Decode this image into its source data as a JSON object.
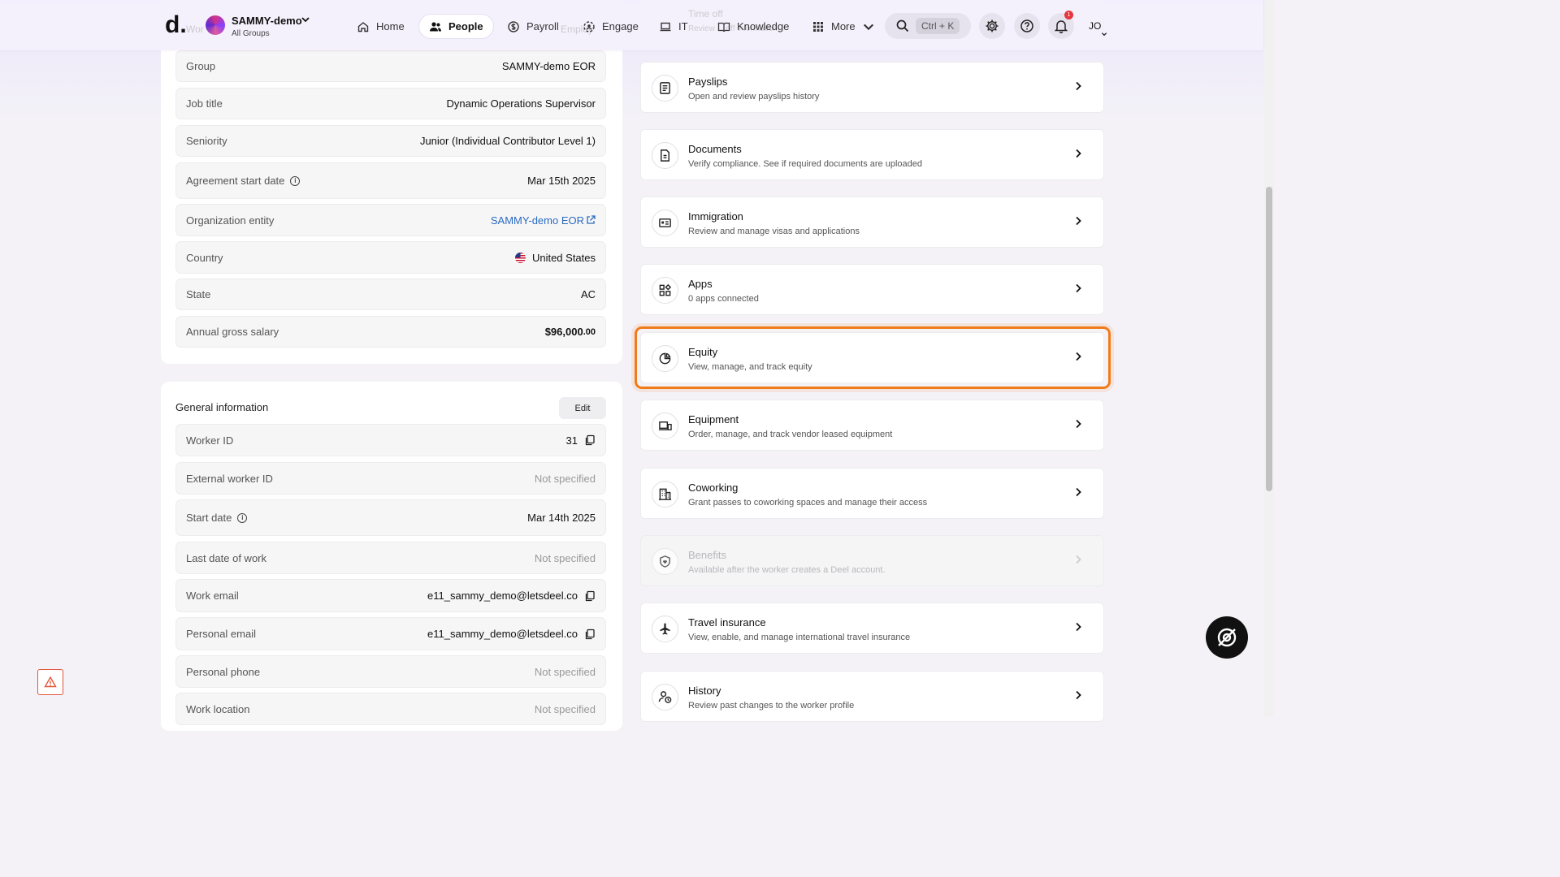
{
  "nav": {
    "org_name": "SAMMY-demo",
    "org_sub": "All Groups",
    "items": [
      {
        "label": "Home",
        "icon": "home-icon"
      },
      {
        "label": "People",
        "icon": "people-icon",
        "active": true
      },
      {
        "label": "Payroll",
        "icon": "dollar-icon"
      },
      {
        "label": "Engage",
        "icon": "engage-icon"
      },
      {
        "label": "IT",
        "icon": "laptop-icon"
      },
      {
        "label": "Knowledge",
        "icon": "book-icon"
      },
      {
        "label": "More",
        "icon": "grid-icon"
      }
    ],
    "search_shortcut": "Ctrl + K",
    "notification_count": "1",
    "user_initials": "JO",
    "ghost_left": "Wor",
    "ghost_mid": "Employ",
    "ghost_right": "Time off",
    "ghost_right_desc": "Review ... off information"
  },
  "employment": {
    "rows": [
      {
        "label": "Group",
        "value": "SAMMY-demo EOR"
      },
      {
        "label": "Job title",
        "value": "Dynamic Operations Supervisor"
      },
      {
        "label": "Seniority",
        "value": "Junior (Individual Contributor Level 1)"
      },
      {
        "label": "Agreement start date",
        "value": "Mar 15th 2025",
        "info": true
      },
      {
        "label": "Organization entity",
        "value": "SAMMY-demo EOR",
        "link": true
      },
      {
        "label": "Country",
        "value": "United States",
        "flag": true
      },
      {
        "label": "State",
        "value": "AC"
      },
      {
        "label": "Annual gross salary",
        "value": "$96,000",
        "cents": ".00"
      }
    ]
  },
  "general": {
    "title": "General information",
    "edit_label": "Edit",
    "rows": [
      {
        "label": "Worker ID",
        "value": "31",
        "copy": true
      },
      {
        "label": "External worker ID",
        "value": "Not specified",
        "muted": true
      },
      {
        "label": "Start date",
        "value": "Mar 14th 2025",
        "info": true
      },
      {
        "label": "Last date of work",
        "value": "Not specified",
        "muted": true
      },
      {
        "label": "Work email",
        "value": "e11_sammy_demo@letsdeel.co",
        "copy": true
      },
      {
        "label": "Personal email",
        "value": "e11_sammy_demo@letsdeel.co",
        "copy": true
      },
      {
        "label": "Personal phone",
        "value": "Not specified",
        "muted": true
      },
      {
        "label": "Work location",
        "value": "Not specified",
        "muted": true
      }
    ]
  },
  "sections": [
    {
      "title": "Payslips",
      "desc": "Open and review payslips history",
      "icon": "payslip-icon"
    },
    {
      "title": "Documents",
      "desc": "Verify compliance. See if required documents are uploaded",
      "icon": "document-icon"
    },
    {
      "title": "Immigration",
      "desc": "Review and manage visas and applications",
      "icon": "id-card-icon"
    },
    {
      "title": "Apps",
      "desc": "0 apps connected",
      "icon": "apps-icon"
    },
    {
      "title": "Equity",
      "desc": "View, manage, and track equity",
      "icon": "pie-chart-icon",
      "highlighted": true
    },
    {
      "title": "Equipment",
      "desc": "Order, manage, and track vendor leased equipment",
      "icon": "devices-icon"
    },
    {
      "title": "Coworking",
      "desc": "Grant passes to coworking spaces and manage their access",
      "icon": "building-icon"
    },
    {
      "title": "Benefits",
      "desc": "Available after the worker creates a Deel account.",
      "icon": "shield-heart-icon",
      "disabled": true
    },
    {
      "title": "Travel insurance",
      "desc": "View, enable, and manage international travel insurance",
      "icon": "airplane-icon"
    },
    {
      "title": "History",
      "desc": "Review past changes to the worker profile",
      "icon": "history-icon"
    }
  ],
  "colors": {
    "highlight": "#f07b1a",
    "link": "#2a6bc0",
    "badge": "#e5363d"
  }
}
